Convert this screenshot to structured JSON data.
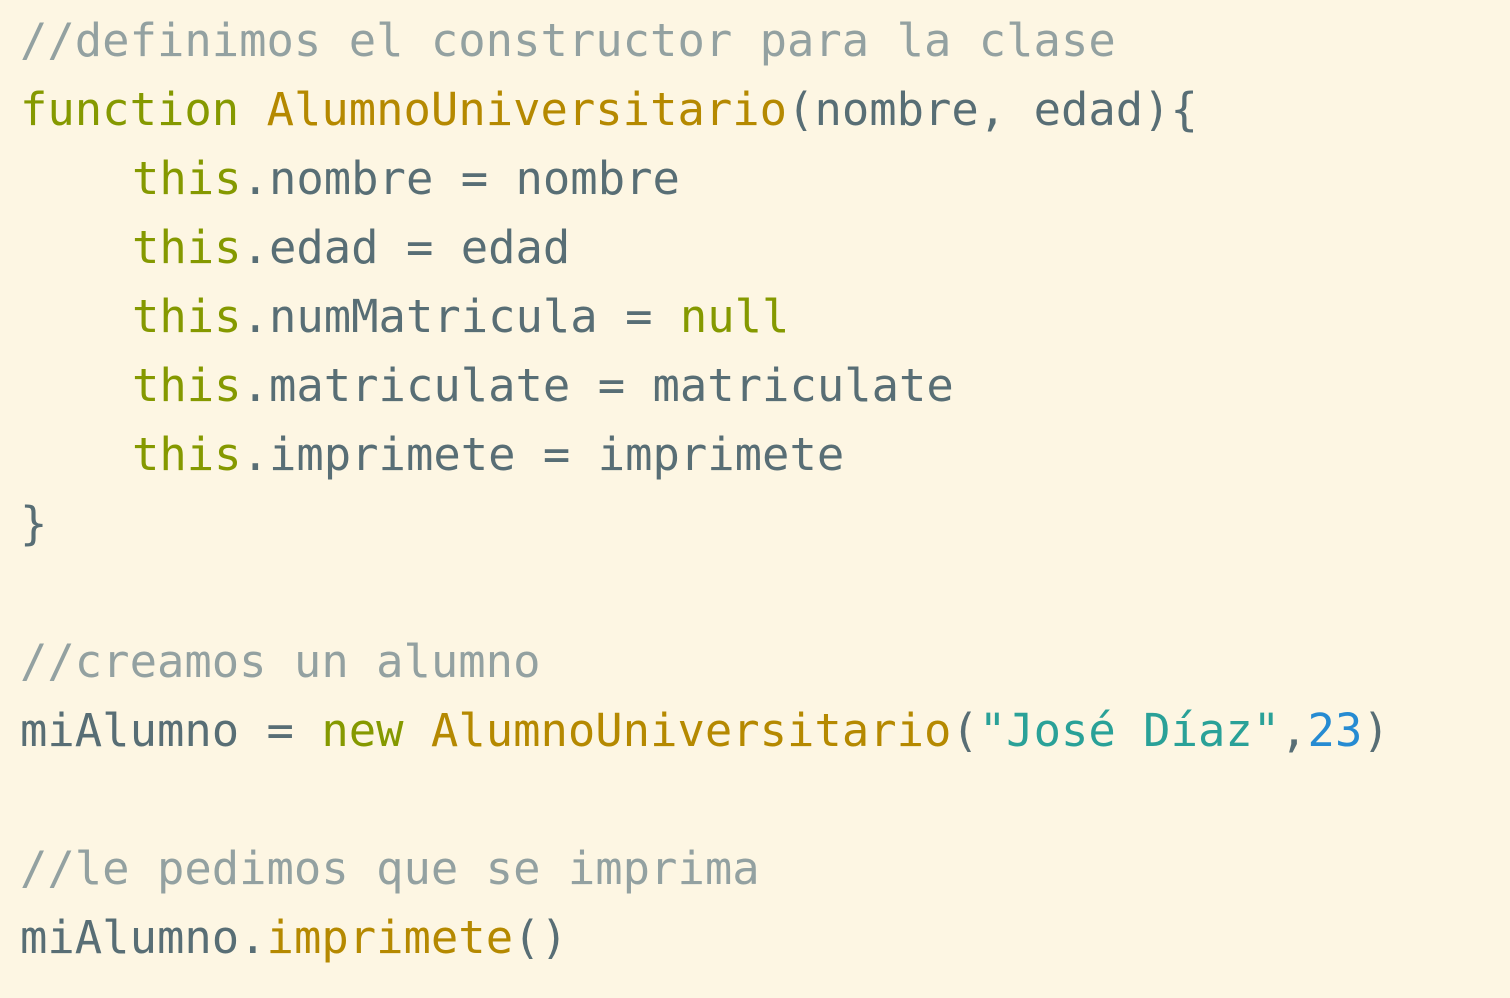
{
  "editor": {
    "lines": [
      {
        "indent": false,
        "tokens": [
          {
            "text": "//definimos el constructor para la clase",
            "kind": "comment"
          }
        ]
      },
      {
        "indent": false,
        "tokens": [
          {
            "text": "function",
            "kind": "keyword"
          },
          {
            "text": " ",
            "kind": "plain"
          },
          {
            "text": "AlumnoUniversitario",
            "kind": "function"
          },
          {
            "text": "(nombre, edad){",
            "kind": "plain"
          }
        ]
      },
      {
        "indent": true,
        "tokens": [
          {
            "text": "this",
            "kind": "keyword"
          },
          {
            "text": ".nombre = nombre",
            "kind": "plain"
          }
        ]
      },
      {
        "indent": true,
        "tokens": [
          {
            "text": "this",
            "kind": "keyword"
          },
          {
            "text": ".edad = edad",
            "kind": "plain"
          }
        ]
      },
      {
        "indent": true,
        "tokens": [
          {
            "text": "this",
            "kind": "keyword"
          },
          {
            "text": ".numMatricula = ",
            "kind": "plain"
          },
          {
            "text": "null",
            "kind": "keyword"
          }
        ]
      },
      {
        "indent": true,
        "tokens": [
          {
            "text": "this",
            "kind": "keyword"
          },
          {
            "text": ".matriculate = matriculate",
            "kind": "plain"
          }
        ]
      },
      {
        "indent": true,
        "tokens": [
          {
            "text": "this",
            "kind": "keyword"
          },
          {
            "text": ".imprimete = imprimete",
            "kind": "plain"
          }
        ]
      },
      {
        "indent": false,
        "tokens": [
          {
            "text": "}",
            "kind": "plain"
          }
        ]
      },
      {
        "indent": false,
        "tokens": []
      },
      {
        "indent": false,
        "tokens": [
          {
            "text": "//creamos un alumno",
            "kind": "comment"
          }
        ]
      },
      {
        "indent": false,
        "tokens": [
          {
            "text": "miAlumno = ",
            "kind": "plain"
          },
          {
            "text": "new",
            "kind": "keyword"
          },
          {
            "text": " ",
            "kind": "plain"
          },
          {
            "text": "AlumnoUniversitario",
            "kind": "function"
          },
          {
            "text": "(",
            "kind": "plain"
          },
          {
            "text": "\"José Díaz\"",
            "kind": "string"
          },
          {
            "text": ",",
            "kind": "plain"
          },
          {
            "text": "23",
            "kind": "number"
          },
          {
            "text": ")",
            "kind": "plain"
          }
        ]
      },
      {
        "indent": false,
        "tokens": []
      },
      {
        "indent": false,
        "tokens": [
          {
            "text": "//le pedimos que se imprima",
            "kind": "comment"
          }
        ]
      },
      {
        "indent": false,
        "tokens": [
          {
            "text": "miAlumno.",
            "kind": "plain"
          },
          {
            "text": "imprimete",
            "kind": "function"
          },
          {
            "text": "()",
            "kind": "plain"
          }
        ]
      }
    ]
  },
  "colors": {
    "background": "#fdf6e3",
    "comment": "#93a1a1",
    "keyword": "#859900",
    "function": "#b58900",
    "plain": "#586e75",
    "string": "#2aa198",
    "number": "#268bd2"
  }
}
